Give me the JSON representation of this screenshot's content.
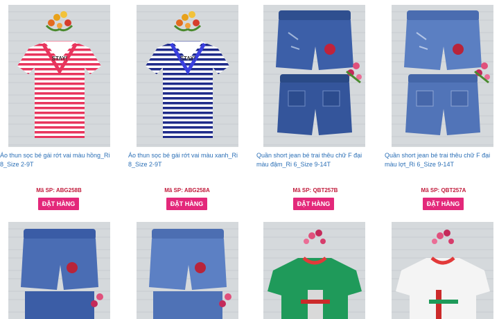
{
  "products": [
    {
      "name": "Áo thun sọc bé gái rớt vai màu hồng_Ri 8_Size 2-9T",
      "sku": "Mã SP: ABG258B",
      "order_label": "ĐẶT HÀNG",
      "image": "pink-striped-tshirt-photo",
      "print_text": "STAY!"
    },
    {
      "name": "Áo thun sọc bé gái rớt vai màu xanh_Ri 8_Size 2-9T",
      "sku": "Mã SP: ABG258A",
      "order_label": "ĐẶT HÀNG",
      "image": "blue-striped-tshirt-photo",
      "print_text": "STAY!"
    },
    {
      "name": "Quần short jean bé trai thêu chữ F đại màu đậm_Ri 6_Size 9-14T",
      "sku": "Mã SP: QBT257B",
      "order_label": "ĐẶT HÀNG",
      "image": "dark-denim-shorts-photo"
    },
    {
      "name": "Quần short jean bé trai thêu chữ F đại màu lợt_Ri 6_Size 9-14T",
      "sku": "Mã SP: QBT257A",
      "order_label": "ĐẶT HÀNG",
      "image": "light-denim-shorts-photo"
    },
    {
      "image": "denim-shorts-photo"
    },
    {
      "image": "light-denim-shorts-photo"
    },
    {
      "image": "green-tshirt-photo"
    },
    {
      "image": "white-tshirt-photo"
    }
  ],
  "colors": {
    "link": "#2b6fb6",
    "sku": "#c11a3b",
    "button": "#e3287a"
  }
}
